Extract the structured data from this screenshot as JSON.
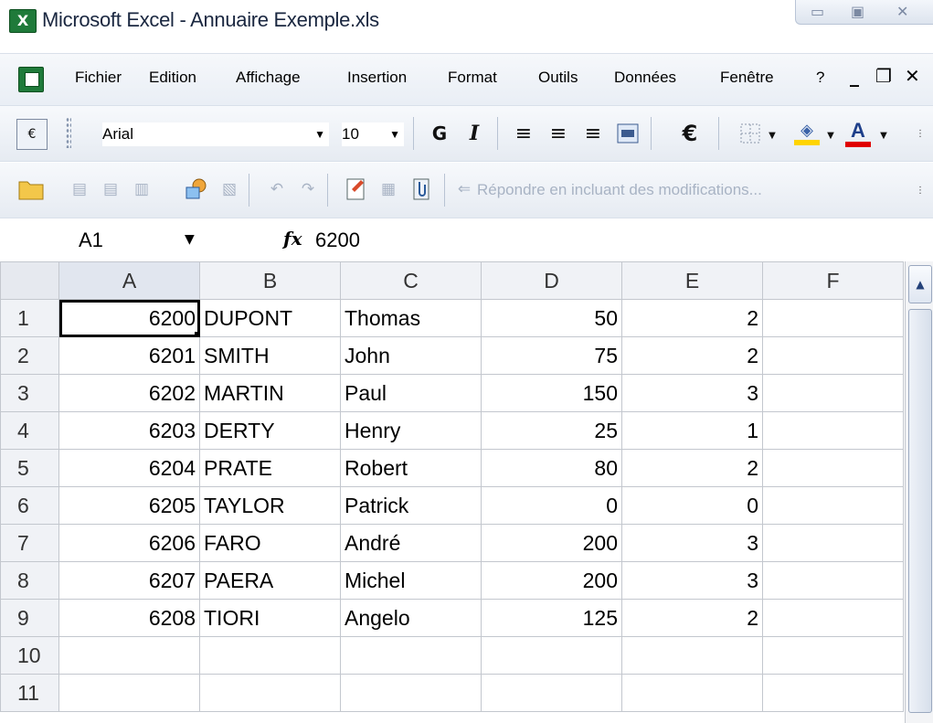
{
  "window": {
    "title": "Microsoft Excel - Annuaire Exemple.xls",
    "app_icon": "excel-icon",
    "controls": [
      "minimize",
      "maximize",
      "close"
    ]
  },
  "menu": {
    "items": [
      "Fichier",
      "Edition",
      "Affichage",
      "Insertion",
      "Format",
      "Outils",
      "Données",
      "Fenêtre",
      "?"
    ],
    "doc_controls": [
      "_",
      "❐",
      "✕"
    ]
  },
  "formatting_toolbar": {
    "font_name": "Arial",
    "font_size": "10",
    "bold_label": "G",
    "italic_label": "I",
    "currency_label": "€",
    "font_color_label": "A",
    "accent_fill": "#ffd400",
    "accent_text": "#e00000"
  },
  "review_toolbar": {
    "reply_label": "Répondre en incluant des modifications..."
  },
  "formula_bar": {
    "name_box": "A1",
    "fx": "fx",
    "value": "6200"
  },
  "sheet": {
    "columns": [
      "A",
      "B",
      "C",
      "D",
      "E",
      "F"
    ],
    "rows": [
      {
        "n": "1",
        "cells": [
          "6200",
          "DUPONT",
          "Thomas",
          "50",
          "2",
          ""
        ]
      },
      {
        "n": "2",
        "cells": [
          "6201",
          "SMITH",
          "John",
          "75",
          "2",
          ""
        ]
      },
      {
        "n": "3",
        "cells": [
          "6202",
          "MARTIN",
          "Paul",
          "150",
          "3",
          ""
        ]
      },
      {
        "n": "4",
        "cells": [
          "6203",
          "DERTY",
          "Henry",
          "25",
          "1",
          ""
        ]
      },
      {
        "n": "5",
        "cells": [
          "6204",
          "PRATE",
          "Robert",
          "80",
          "2",
          ""
        ]
      },
      {
        "n": "6",
        "cells": [
          "6205",
          "TAYLOR",
          "Patrick",
          "0",
          "0",
          ""
        ]
      },
      {
        "n": "7",
        "cells": [
          "6206",
          "FARO",
          "André",
          "200",
          "3",
          ""
        ]
      },
      {
        "n": "8",
        "cells": [
          "6207",
          "PAERA",
          "Michel",
          "200",
          "3",
          ""
        ]
      },
      {
        "n": "9",
        "cells": [
          "6208",
          "TIORI",
          "Angelo",
          "125",
          "2",
          ""
        ]
      },
      {
        "n": "10",
        "cells": [
          "",
          "",
          "",
          "",
          "",
          ""
        ]
      },
      {
        "n": "11",
        "cells": [
          "",
          "",
          "",
          "",
          "",
          ""
        ]
      }
    ],
    "active_cell": "A1"
  }
}
